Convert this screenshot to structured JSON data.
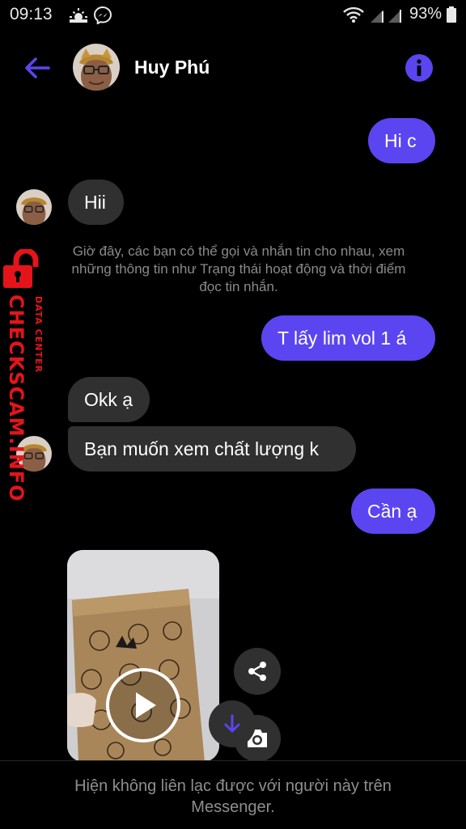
{
  "status_bar": {
    "time": "09:13",
    "battery": "93%",
    "icons": [
      "weather-icon",
      "messenger-icon",
      "wifi-icon",
      "signal-icon",
      "battery-icon"
    ]
  },
  "header": {
    "contact_name": "Huy Phú",
    "icons": [
      "back-arrow-icon",
      "info-icon"
    ]
  },
  "messages": {
    "m1": "Hi c",
    "m2": "Hii",
    "system": "Giờ đây, các bạn có thể gọi và nhắn tin cho nhau, xem những thông tin như Trạng thái hoạt động và thời điểm đọc tin nhắn.",
    "m3": "T lấy lim vol 1 á",
    "m4": "Okk ạ",
    "m5": "Bạn muốn xem chất lượng k",
    "m6": "Cần ạ"
  },
  "watermark": {
    "brand": "CHECKSCAM.INFO",
    "tagline": "DATA CENTER"
  },
  "footer": {
    "notice": "Hiện không liên lạc được với người này trên Messenger."
  },
  "colors": {
    "accent": "#5b45f0",
    "incoming_bubble": "#303030",
    "watermark": "#e5141b",
    "background": "#000000"
  }
}
